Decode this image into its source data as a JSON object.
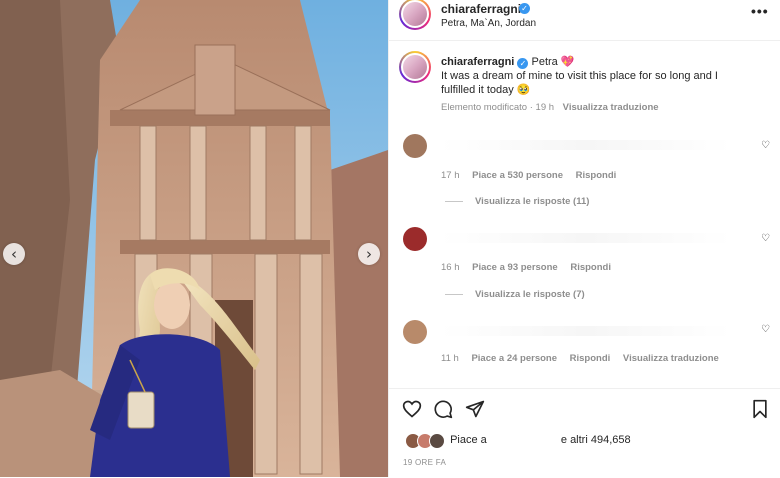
{
  "post": {
    "username": "chiaraferragni",
    "location": "Petra, Ma`An, Jordan",
    "more_label": "•••",
    "photo_alt": "Woman in blue outfit in front of the Treasury at Petra"
  },
  "caption": {
    "username": "chiaraferragni",
    "title": "Petra",
    "title_emoji": "💖",
    "text_line1": "It was a dream of mine to visit this place for so long and I",
    "text_line2": "fulfilled it today",
    "text_emoji": "🥹",
    "edited_label": "Elemento modificato",
    "time": "19 h",
    "translate_label": "Visualizza traduzione"
  },
  "comments": [
    {
      "time": "17 h",
      "likes": "Piace a 530 persone",
      "reply": "Rispondi",
      "translate": "",
      "view_replies": "Visualizza le risposte (11)",
      "avatar_color": "#a0775e"
    },
    {
      "time": "16 h",
      "likes": "Piace a 93 persone",
      "reply": "Rispondi",
      "translate": "",
      "view_replies": "Visualizza le risposte (7)",
      "avatar_color": "#9b2b2b"
    },
    {
      "time": "11 h",
      "likes": "Piace a 24 persone",
      "reply": "Rispondi",
      "translate": "Visualizza traduzione",
      "view_replies": "",
      "avatar_color": "#b88a6a"
    }
  ],
  "likes_summary": {
    "prefix": "Piace a",
    "suffix": "e altri 494,658",
    "avatar_colors": [
      "#8a5a44",
      "#c77b6b",
      "#5a4a42"
    ]
  },
  "posted_date": "19 ORE FA",
  "colors": {
    "verified": "#3897f0",
    "secondary_text": "#8e8e8e",
    "primary_text": "#262626"
  }
}
